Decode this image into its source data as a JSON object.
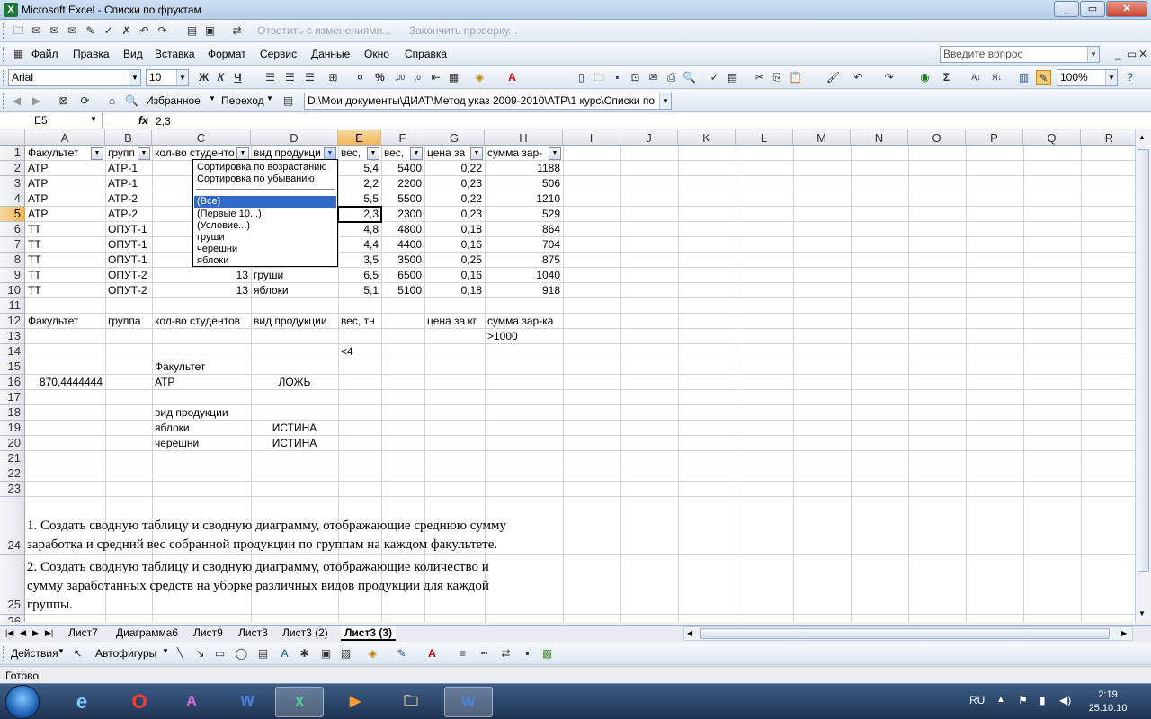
{
  "window": {
    "title": "Microsoft Excel - Списки по фруктам"
  },
  "menu": {
    "items": [
      "Файл",
      "Правка",
      "Вид",
      "Вставка",
      "Формат",
      "Сервис",
      "Данные",
      "Окно",
      "Справка"
    ],
    "help_placeholder": "Введите вопрос"
  },
  "review_toolbar": {
    "reply_label": "Ответить с изменениями...",
    "finish_label": "Закончить проверку..."
  },
  "format_toolbar": {
    "font": "Arial",
    "size": "10",
    "bold": "Ж",
    "italic": "К",
    "underline": "Ч",
    "percent": "%",
    "zoom": "100%"
  },
  "web_toolbar": {
    "favorites": "Избранное",
    "goto": "Переход",
    "path": "D:\\Мои документы\\ДИАТ\\Метод указ 2009-2010\\АТР\\1 курс\\Списки по"
  },
  "formula_bar": {
    "name_box": "E5",
    "fx": "fx",
    "value": "2,3"
  },
  "columns": [
    "A",
    "B",
    "C",
    "D",
    "E",
    "F",
    "G",
    "H",
    "I",
    "J",
    "K",
    "L",
    "M",
    "N",
    "O",
    "P",
    "Q",
    "R"
  ],
  "rows": [
    "1",
    "2",
    "3",
    "4",
    "5",
    "6",
    "7",
    "8",
    "9",
    "10",
    "11",
    "12",
    "13",
    "14",
    "15",
    "16",
    "17",
    "18",
    "19",
    "20",
    "21",
    "22",
    "23",
    "24",
    "25",
    "26"
  ],
  "header_row": {
    "a": "Факультет",
    "b": "групп",
    "c": "кол-во студенто",
    "d": "вид продукци",
    "e": "вес,",
    "f": "вес,",
    "g": "цена за",
    "h": "сумма зар-"
  },
  "data_rows": [
    {
      "a": "АТР",
      "b": "АТР-1",
      "c": "",
      "d": "",
      "e": "5,4",
      "f": "5400",
      "g": "0,22",
      "h": "1188"
    },
    {
      "a": "АТР",
      "b": "АТР-1",
      "c": "",
      "d": "",
      "e": "2,2",
      "f": "2200",
      "g": "0,23",
      "h": "506"
    },
    {
      "a": "АТР",
      "b": "АТР-2",
      "c": "",
      "d": "",
      "e": "5,5",
      "f": "5500",
      "g": "0,22",
      "h": "1210"
    },
    {
      "a": "АТР",
      "b": "АТР-2",
      "c": "",
      "d": "",
      "e": "2,3",
      "f": "2300",
      "g": "0,23",
      "h": "529"
    },
    {
      "a": "ТТ",
      "b": "ОПУТ-1",
      "c": "",
      "d": "",
      "e": "4,8",
      "f": "4800",
      "g": "0,18",
      "h": "864"
    },
    {
      "a": "ТТ",
      "b": "ОПУТ-1",
      "c": "",
      "d": "",
      "e": "4,4",
      "f": "4400",
      "g": "0,16",
      "h": "704"
    },
    {
      "a": "ТТ",
      "b": "ОПУТ-1",
      "c": "",
      "d": "",
      "e": "3,5",
      "f": "3500",
      "g": "0,25",
      "h": "875"
    },
    {
      "a": "ТТ",
      "b": "ОПУТ-2",
      "c": "13",
      "d": "груши",
      "e": "6,5",
      "f": "6500",
      "g": "0,16",
      "h": "1040"
    },
    {
      "a": "ТТ",
      "b": "ОПУТ-2",
      "c": "13",
      "d": "яблоки",
      "e": "5,1",
      "f": "5100",
      "g": "0,18",
      "h": "918"
    }
  ],
  "criteria": {
    "row12": {
      "a": "Факультет",
      "b": "группа",
      "c": "кол-во студентов",
      "d": "вид продукции",
      "e": "вес, тн",
      "g": "цена за кг",
      "h": "сумма зар-ка"
    },
    "h13": ">1000",
    "e14": "<4",
    "c15": "Факультет",
    "a16": "870,4444444",
    "c16": "АТР",
    "d16": "ЛОЖЬ",
    "c18": "вид продукции",
    "c19": "яблоки",
    "d19": "ИСТИНА",
    "c20": "черешни",
    "d20": "ИСТИНА"
  },
  "tasks": {
    "t1_line1": "1.      Создать сводную таблицу и сводную диаграмму, отображающие среднюю сумму",
    "t1_line2": "заработка и средний вес собранной продукции по группам на каждом факультете.",
    "t2_line1": "2.      Создать сводную таблицу и сводную диаграмму, отображающие количество и",
    "t2_line2": "сумму заработанных средств на уборке различных видов продукции для каждой",
    "t2_line3": "группы."
  },
  "autofilter_menu": {
    "items": [
      "Сортировка по возрастанию",
      "Сортировка по убыванию",
      "(Все)",
      "(Первые 10...)",
      "(Условие...)",
      "груши",
      "черешни",
      "яблоки"
    ],
    "selected": "(Все)"
  },
  "sheet_tabs": [
    "Лист7",
    "Диаграмма6",
    "Лист9",
    "Лист3",
    "Лист3 (2)",
    "Лист3 (3)"
  ],
  "active_sheet": "Лист3 (3)",
  "drawing_toolbar": {
    "actions": "Действия",
    "autoshapes": "Автофигуры"
  },
  "status": {
    "text": "Готово"
  },
  "taskbar": {
    "lang": "RU",
    "time": "2:19",
    "date": "25.10.10"
  }
}
